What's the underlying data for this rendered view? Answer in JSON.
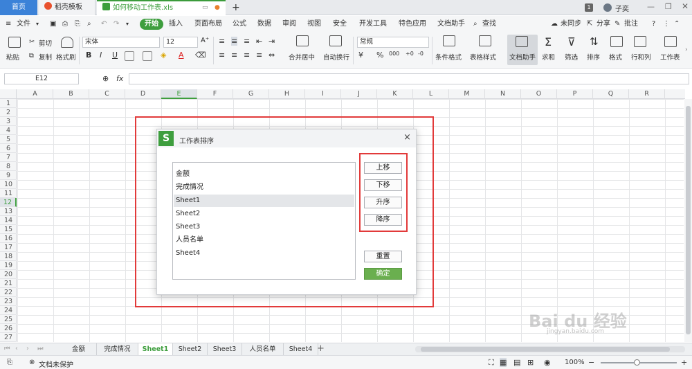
{
  "tabbar": {
    "home": "首页",
    "template_tab": "稻壳模板",
    "file_tab": "如何移动工作表.xls",
    "new_tab": "+",
    "badge": "1",
    "user": "子奕"
  },
  "menubar": {
    "file": "文件",
    "items": [
      "开始",
      "插入",
      "页面布局",
      "公式",
      "数据",
      "审阅",
      "视图",
      "安全",
      "开发工具",
      "特色应用",
      "文档助手"
    ],
    "search": "查找",
    "sync": "未同步",
    "share": "分享",
    "comment": "批注"
  },
  "ribbon": {
    "paste": "粘贴",
    "cut": "剪切",
    "copy": "复制",
    "format_painter": "格式刷",
    "font_name": "宋体",
    "font_size": "12",
    "bold": "B",
    "italic": "I",
    "underline": "U",
    "font_color": "A",
    "merge_center": "合并居中",
    "wrap_text": "自动换行",
    "number_format": "常规",
    "percent": "%",
    "thousands": "000",
    "cond_format": "条件格式",
    "table_style": "表格样式",
    "doc_helper": "文档助手",
    "sum": "求和",
    "filter": "筛选",
    "sort": "排序",
    "format": "格式",
    "row_col": "行和列",
    "worksheet": "工作表"
  },
  "formula_bar": {
    "cell_ref": "E12",
    "fx": "fx",
    "value": ""
  },
  "grid": {
    "columns": [
      "A",
      "B",
      "C",
      "D",
      "E",
      "F",
      "G",
      "H",
      "I",
      "J",
      "K",
      "L",
      "M",
      "N",
      "O",
      "P",
      "Q",
      "R"
    ],
    "rows": [
      "1",
      "2",
      "3",
      "4",
      "5",
      "6",
      "7",
      "8",
      "9",
      "10",
      "11",
      "12",
      "13",
      "14",
      "15",
      "16",
      "17",
      "18",
      "19",
      "20",
      "21",
      "22",
      "23",
      "24",
      "25",
      "26",
      "27"
    ],
    "selected_column": "E",
    "selected_row": "12"
  },
  "dialog": {
    "title": "工作表排序",
    "logo": "S",
    "close": "×",
    "sheets": [
      "金额",
      "完成情况",
      "Sheet1",
      "Sheet2",
      "Sheet3",
      "人员名单",
      "Sheet4"
    ],
    "selected_sheet": "Sheet1",
    "buttons": {
      "move_up": "上移",
      "move_down": "下移",
      "ascending": "升序",
      "descending": "降序",
      "reset": "重置",
      "ok": "确定"
    }
  },
  "sheet_tabs": [
    "金额",
    "完成情况",
    "Sheet1",
    "Sheet2",
    "Sheet3",
    "人员名单",
    "Sheet4"
  ],
  "active_sheet": "Sheet1",
  "status": {
    "protect": "文档未保护",
    "zoom": "100%"
  },
  "watermark": {
    "brand": "Bai du 经验",
    "url": "jingyan.baidu.com"
  },
  "colors": {
    "accent_green": "#3e9e3e",
    "home_tab_blue": "#3b82d8",
    "highlight_red": "#e23a3a",
    "ok_button": "#6aaf4f"
  }
}
